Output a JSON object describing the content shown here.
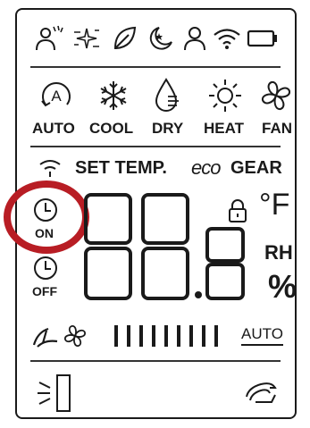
{
  "top_icons": [
    "light-sensor-icon",
    "sparkle-icon",
    "leaf-icon",
    "sleep-moon-icon",
    "person-icon",
    "wifi-icon",
    "battery-icon"
  ],
  "modes": [
    {
      "label": "AUTO",
      "icon": "auto-mode-icon"
    },
    {
      "label": "COOL",
      "icon": "snowflake-icon"
    },
    {
      "label": "DRY",
      "icon": "droplet-icon"
    },
    {
      "label": "HEAT",
      "icon": "sun-icon"
    },
    {
      "label": "FAN",
      "icon": "fan-icon"
    }
  ],
  "status_row": {
    "set_temp": "SET TEMP.",
    "eco": "eco",
    "gear": "GEAR"
  },
  "timer_on": "ON",
  "timer_off": "OFF",
  "display": {
    "digits": "88.8",
    "unit_f": "°F",
    "unit_rh": "RH",
    "unit_pct": "%"
  },
  "fan_speed": {
    "bar_count": 9,
    "auto_label": "AUTO"
  },
  "highlight_color": "#b81d24"
}
